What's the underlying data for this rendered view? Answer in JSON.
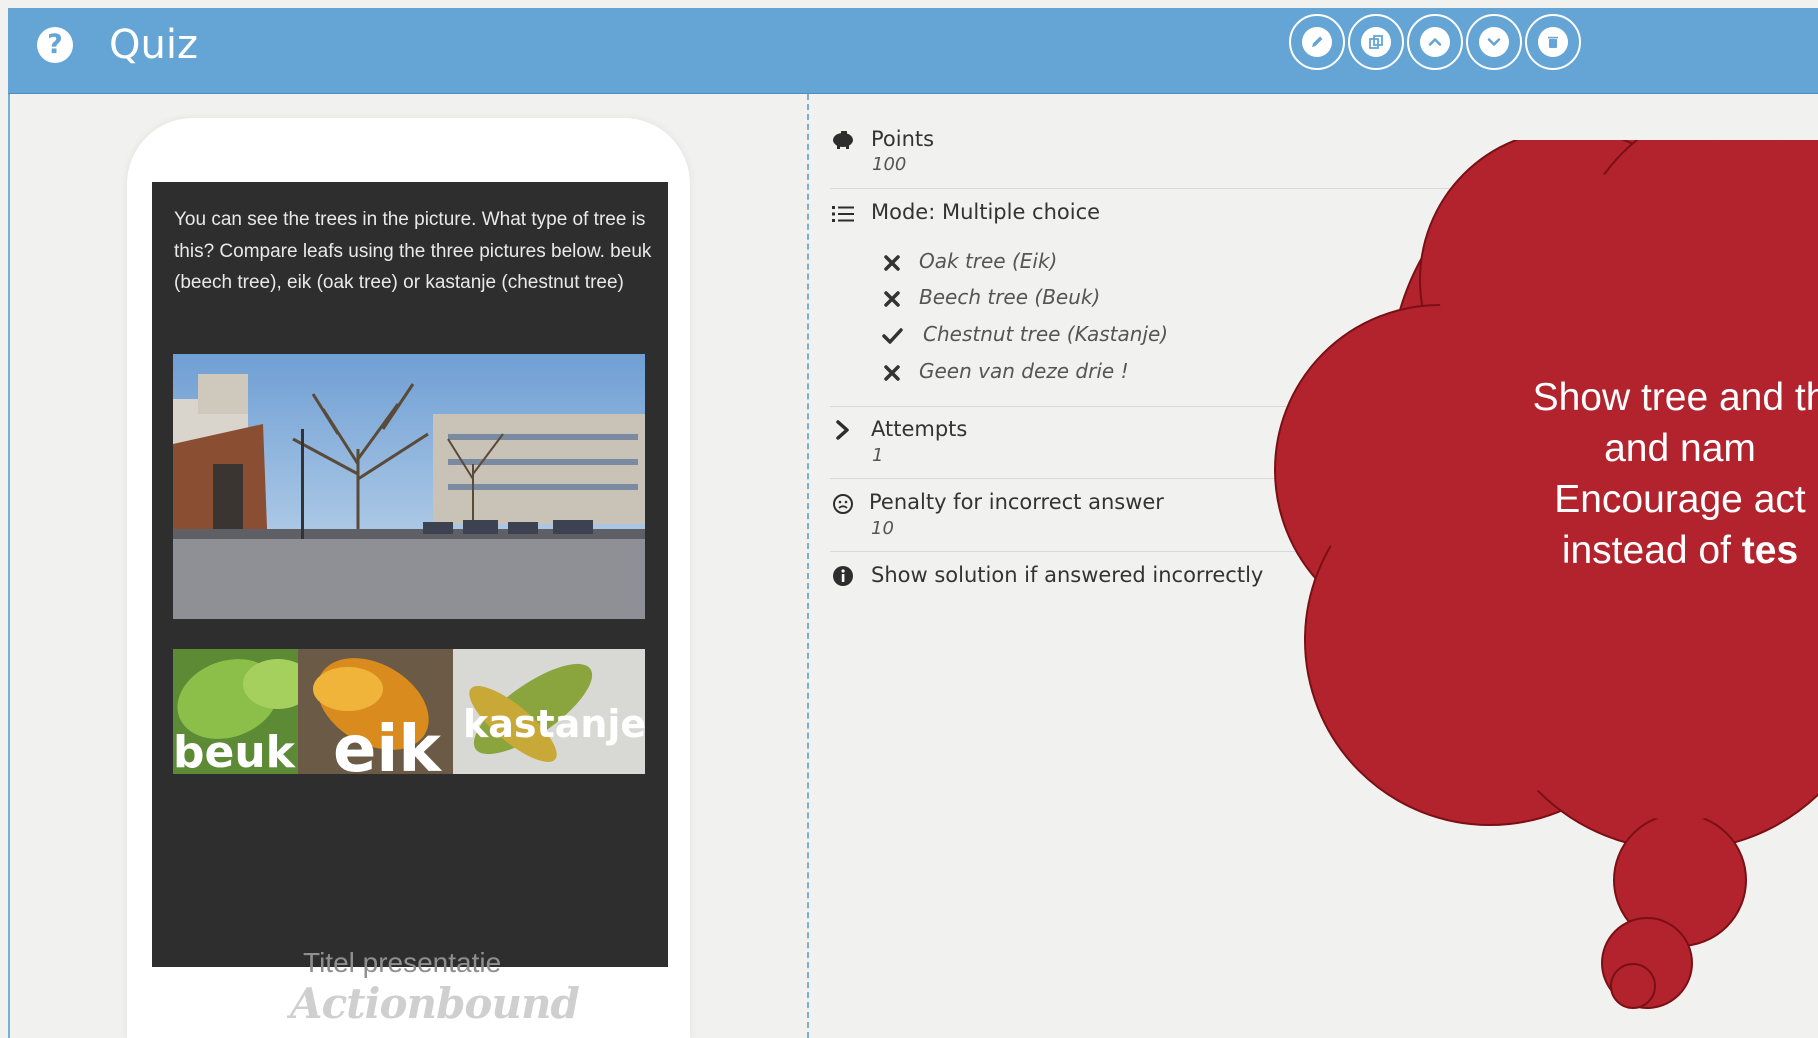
{
  "header": {
    "title": "Quiz",
    "icons": [
      "help-icon",
      "pencil-icon",
      "copy-icon",
      "chevron-up-icon",
      "chevron-down-icon",
      "trash-icon"
    ],
    "colors": {
      "header_bg": "#65a5d6",
      "accent": "#7aaed6"
    }
  },
  "preview": {
    "question": "You can see the trees in the picture. What type of tree is this? Compare leafs using the three pictures below. beuk (beech tree), eik (oak tree) or kastanje (chestnut tree)",
    "leaf_labels": {
      "beuk": "beuk",
      "eik": "eik",
      "kastanje": "kastanje"
    },
    "caption": "Titel presentatie",
    "brand": "Actionbound",
    "colors": {
      "screen_bg": "#2e2e2e"
    }
  },
  "properties": {
    "points": {
      "label": "Points",
      "value": "100",
      "icon": "piggy-bank-icon"
    },
    "mode": {
      "label": "Mode: Multiple choice",
      "icon": "list-icon",
      "options": [
        {
          "text": "Oak tree (Eik)",
          "correct": false
        },
        {
          "text": "Beech tree (Beuk)",
          "correct": false
        },
        {
          "text": "Chestnut tree (Kastanje)",
          "correct": true
        },
        {
          "text": "Geen van deze drie !",
          "correct": false
        }
      ]
    },
    "attempts": {
      "label": "Attempts",
      "value": "1",
      "icon": "chevron-right-icon"
    },
    "penalty": {
      "label": "Penalty for incorrect answer",
      "value": "10",
      "icon": "sad-face-icon"
    },
    "solution": {
      "label": "Show solution if answered incorrectly",
      "icon": "info-icon"
    }
  },
  "bubble": {
    "line1": "Show tree and th",
    "line2": "and nam",
    "line3": "Encourage act",
    "line4_prefix": "instead of ",
    "line4_bold": "tes",
    "color": "#b2232d"
  }
}
